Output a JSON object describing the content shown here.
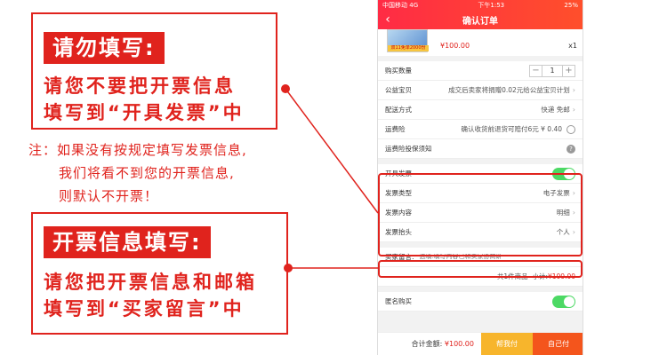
{
  "note1": {
    "tag": "请勿填写:",
    "line1": "请您不要把开票信息",
    "line2": "填写到“开具发票”中"
  },
  "warning": {
    "line1": "注：如果没有按规定填写发票信息,",
    "line2": "我们将看不到您的开票信息,",
    "line3": "则默认不开票！"
  },
  "note2": {
    "tag": "开票信息填写:",
    "line1": "请您把开票信息和邮箱",
    "line2": "填写到“买家留言”中"
  },
  "colors": {
    "accent": "#e0231d",
    "toggle_on": "#4cd964",
    "pay_other": "#f7b52c",
    "pay_self": "#f4551c"
  },
  "phone": {
    "status": {
      "carrier": "中国移动",
      "network": "4G",
      "time": "下午1:53",
      "battery": "25%"
    },
    "nav": {
      "back_icon": "chevron-left-icon",
      "title": "确认订单"
    },
    "product": {
      "price": "¥100.00",
      "qty": "x1",
      "badge": "双11免单2000份"
    },
    "rows": {
      "quantity": {
        "label": "购买数量",
        "minus": "−",
        "value": "1",
        "plus": "+"
      },
      "charity": {
        "label": "公益宝贝",
        "value": "成交后卖家将捐赠0.02元给公益宝贝计划"
      },
      "delivery": {
        "label": "配送方式",
        "value": "快递 免邮"
      },
      "insurance": {
        "label": "运费险",
        "value": "确认收货前退货可赔付6元",
        "amount": "¥ 0.40"
      },
      "insurance_notice": {
        "label": "运费险投保须知"
      },
      "invoice": {
        "label": "开具发票"
      },
      "invoice_type": {
        "label": "发票类型",
        "value": "电子发票"
      },
      "invoice_content": {
        "label": "发票内容",
        "value": "明细"
      },
      "invoice_title": {
        "label": "发票抬头",
        "value": "个人"
      },
      "message": {
        "label": "买家留言:",
        "placeholder": "选填:填写内容已和卖家协商确认"
      },
      "subtotal": {
        "count": "共1件商品",
        "label": "小计:",
        "value": "¥100.00"
      },
      "anonymous": {
        "label": "匿名购买"
      }
    },
    "bottom": {
      "total_label": "合计金额:",
      "total_value": "¥100.00",
      "pay_other": "帮我付",
      "pay_self": "自己付"
    }
  }
}
